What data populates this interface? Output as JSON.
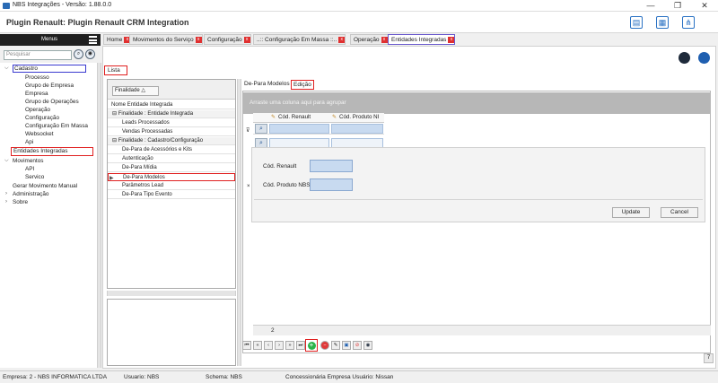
{
  "window": {
    "title": "NBS Integrações - Versão: 1.88.0.0",
    "minimize": "—",
    "maximize": "❐",
    "close": "✕"
  },
  "header": {
    "title": "Plugin Renault: Plugin Renault CRM Integration"
  },
  "menu": {
    "title": "Menus",
    "search_placeholder": "Pesquisar",
    "items": [
      {
        "label": "Cadastro"
      },
      {
        "label": "Processo"
      },
      {
        "label": "Grupo de Empresa"
      },
      {
        "label": "Empresa"
      },
      {
        "label": "Grupo de Operações"
      },
      {
        "label": "Operação"
      },
      {
        "label": "Configuração"
      },
      {
        "label": "Configuração Em Massa"
      },
      {
        "label": "Websocket"
      },
      {
        "label": "Api"
      },
      {
        "label": "Entidades Integradas"
      },
      {
        "label": "Movimentos"
      },
      {
        "label": "API"
      },
      {
        "label": "Servico"
      },
      {
        "label": "Gerar Movimento Manual"
      },
      {
        "label": "Administração"
      },
      {
        "label": "Sobre"
      }
    ]
  },
  "tabs": [
    {
      "label": "Home"
    },
    {
      "label": "Movimentos do Serviço"
    },
    {
      "label": "Configuração"
    },
    {
      "label": "..:: Configuração Em Massa ::.."
    },
    {
      "label": "Operação"
    },
    {
      "label": "Entidades Integradas"
    }
  ],
  "tab_close": "x",
  "lista_label": "Lista",
  "entity_grid": {
    "group_chip": "Finalidade",
    "column": "Nome Entidade Integrada",
    "rows": [
      {
        "label": "Finalidade : Entidade Integrada"
      },
      {
        "label": "Leads Processados"
      },
      {
        "label": "Vendas Processadas"
      },
      {
        "label": "Finalidade : Cadastro/Configuração"
      },
      {
        "label": "De-Para de Acessórios e Kits"
      },
      {
        "label": "Autenticação"
      },
      {
        "label": "De-Para Mídia"
      },
      {
        "label": "De-Para Modelos"
      },
      {
        "label": "Parâmetros Lead"
      },
      {
        "label": "De-Para Tipo Evento"
      }
    ]
  },
  "detail": {
    "tabs": [
      {
        "label": "De-Para Modelos"
      },
      {
        "label": "Edição"
      }
    ],
    "group_hint": "Arraste uma coluna aqui para agrupar",
    "columns": [
      {
        "label": "Cód. Renault"
      },
      {
        "label": "Cód. Produto NI"
      }
    ],
    "form": {
      "renault_label": "Cód. Renault",
      "produto_label": "Cód. Produto NBS",
      "update": "Update",
      "cancel": "Cancel"
    },
    "count": "2",
    "page_btn": "7"
  },
  "status": {
    "empresa": "Empresa: 2 - NBS INFORMATICA LTDA",
    "usuario": "Usuario: NBS",
    "schema": "Schema: NBS",
    "concessionaria": "Concessionária Empresa Usuário: Nissan"
  },
  "colors": {
    "accent": "#2a72c4",
    "highlight_red": "#e02020",
    "highlight_blue": "#3a3ad0"
  }
}
